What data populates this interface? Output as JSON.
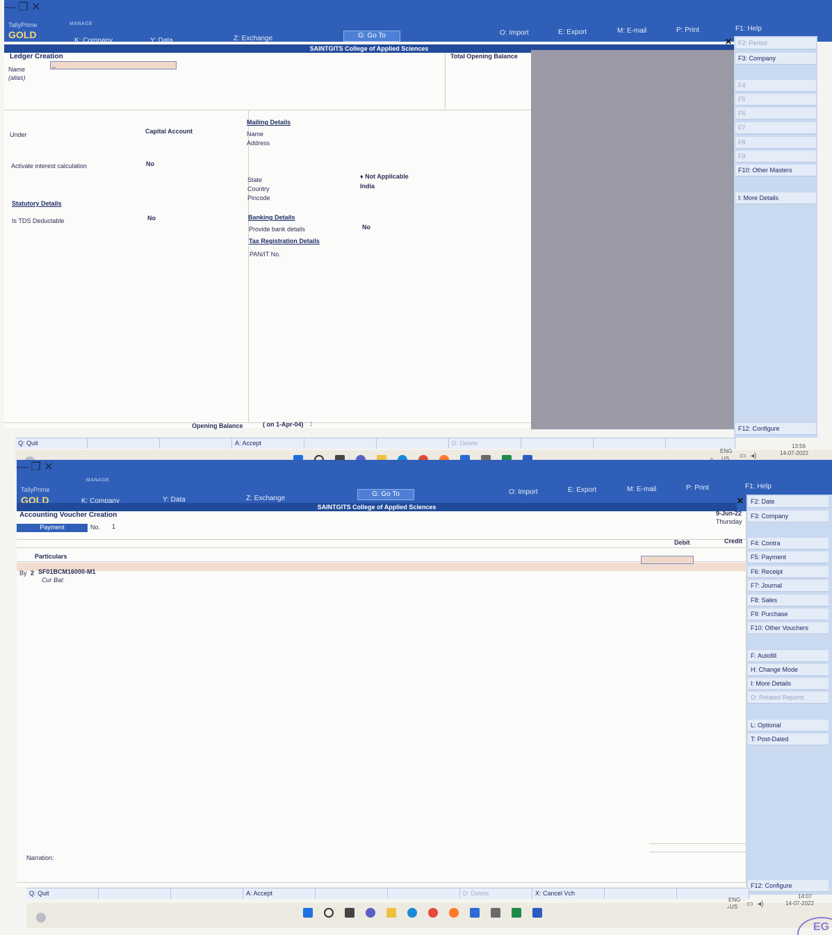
{
  "colors": {
    "title_bar": "#2f5fb8",
    "brand_gold": "#f6d77a",
    "form_bg": "#fbfbf9",
    "sidebar_bg": "#c9d9f0",
    "grey_pane": "#9b99a6",
    "field_highlight": "#f2d8c9"
  },
  "screen1": {
    "app": {
      "brand": "TallyPrime",
      "edition_tag": "MANAGE",
      "edition": "GOLD"
    },
    "menu": {
      "company": "K: Company",
      "data": "Y: Data",
      "exchange": "Z: Exchange",
      "goto": "G: Go To",
      "import": "O: Import",
      "export": "E: Export",
      "email": "M: E-mail",
      "print": "P: Print",
      "help": "F1: Help"
    },
    "company_name": "SAINTGITS College of Applied Sciences",
    "screen_title": "Ledger Creation",
    "name_label": "Name",
    "alias_label": "(alias)",
    "name_value": "_",
    "total_opening_balance_label": "Total Opening Balance",
    "under_label": "Under",
    "under_value": "Capital Account",
    "interest_label": "Activate interest calculation",
    "interest_value": "No",
    "statutory_header": "Statutory Details",
    "tds_label": "Is TDS Deductable",
    "tds_value": "No",
    "mailing_header": "Mailing Details",
    "mail_name": "Name",
    "mail_address": "Address",
    "state_label": "State",
    "state_value": "♦ Not Applicable",
    "country_label": "Country",
    "country_value": "India",
    "pincode_label": "Pincode",
    "banking_header": "Banking Details",
    "bank_label": "Provide bank details",
    "bank_value": "No",
    "tax_header": "Tax Registration Details",
    "pan_label": "PAN/IT No.",
    "opening_balance_label": "Opening Balance",
    "opening_balance_date": "( on 1-Apr-04)",
    "opening_balance_colon": ":",
    "sidebar": {
      "f2": "F2: Period",
      "f3": "F3: Company",
      "f4": "F4",
      "f5": "F5",
      "f6": "F6",
      "f7": "F7",
      "f8": "F8",
      "f9": "F9",
      "f10": "F10: Other Masters",
      "more": "I: More Details",
      "f12": "F12: Configure"
    },
    "bottom": {
      "quit": "Q: Quit",
      "accept": "A: Accept",
      "delete": "D: Delete"
    },
    "tray": {
      "lang": "ENG",
      "region": "US",
      "time": "13:56",
      "date": "14-07-2022"
    }
  },
  "screen2": {
    "app": {
      "brand": "TallyPrime",
      "edition_tag": "MANAGE",
      "edition": "GOLD"
    },
    "menu": {
      "company": "K: Company",
      "data": "Y: Data",
      "exchange": "Z: Exchange",
      "goto": "G: Go To",
      "import": "O: Import",
      "export": "E: Export",
      "email": "M: E-mail",
      "print": "P: Print",
      "help": "F1: Help"
    },
    "company_name": "SAINTGITS College of Applied Sciences",
    "screen_title": "Accounting Voucher Creation",
    "voucher_type": "Payment",
    "voucher_no_label": "No.",
    "voucher_no": "1",
    "date": "9-Jun-22",
    "day": "Thursday",
    "particulars_label": "Particulars",
    "debit_label": "Debit",
    "credit_label": "Credit",
    "entry_prefix": "By",
    "entry_no": "2",
    "entry_ledger": "SF01BCM16000-M1",
    "cur_bal_label": "Cur Bal:",
    "narration_label": "Narration:",
    "sidebar": {
      "f2": "F2: Date",
      "f3": "F3: Company",
      "f4": "F4: Contra",
      "f5": "F5: Payment",
      "f6": "F6: Receipt",
      "f7": "F7: Journal",
      "f8": "F8: Sales",
      "f9": "F9: Purchase",
      "f10": "F10: Other Vouchers",
      "autofill": "F: Autofill",
      "change_mode": "H: Change Mode",
      "more": "I: More Details",
      "related": "O: Related Reports",
      "optional": "L: Optional",
      "post_dated": "T: Post-Dated",
      "f12": "F12: Configure"
    },
    "bottom": {
      "quit": "Q: Quit",
      "accept": "A: Accept",
      "delete": "D: Delete",
      "cancel": "X: Cancel Vch"
    },
    "tray": {
      "lang": "ENG",
      "region": "US",
      "time": "14:07",
      "date": "14-07-2022"
    }
  },
  "taskbar_icons": [
    "windows-icon",
    "search-icon",
    "file-explorer-icon",
    "chat-icon",
    "folder-icon",
    "edge-icon",
    "chrome-icon",
    "firefox-icon",
    "store-icon",
    "media-icon",
    "excel-icon",
    "word-icon"
  ],
  "stamp_text": "EG"
}
